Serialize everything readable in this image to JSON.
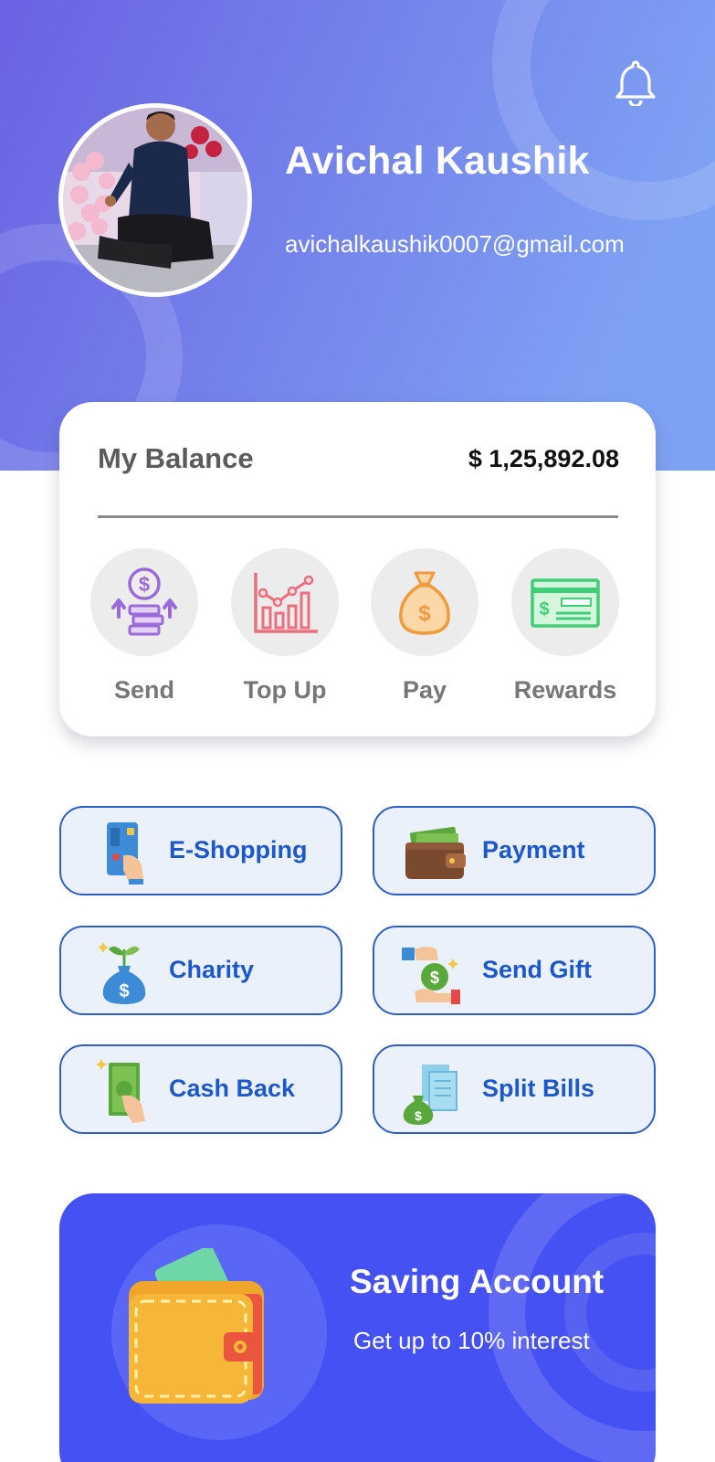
{
  "profile": {
    "name": "Avichal Kaushik",
    "email": "avichalkaushik0007@gmail.com"
  },
  "header": {
    "notification_icon": "bell-icon",
    "gradient_start": "#6a62e3",
    "gradient_end": "#7ea2f3"
  },
  "balance": {
    "label": "My Balance",
    "value": "$ 1,25,892.08"
  },
  "actions": [
    {
      "label": "Send",
      "icon": "send-money-icon"
    },
    {
      "label": "Top Up",
      "icon": "chart-icon"
    },
    {
      "label": "Pay",
      "icon": "money-bag-icon"
    },
    {
      "label": "Rewards",
      "icon": "cheque-icon"
    }
  ],
  "services": [
    {
      "label": "E-Shopping",
      "icon": "card-hand-icon"
    },
    {
      "label": "Payment",
      "icon": "wallet-icon"
    },
    {
      "label": "Charity",
      "icon": "plant-bag-icon"
    },
    {
      "label": "Send Gift",
      "icon": "gift-exchange-icon"
    },
    {
      "label": "Cash Back",
      "icon": "cash-hand-icon"
    },
    {
      "label": "Split Bills",
      "icon": "bills-icon"
    }
  ],
  "promo": {
    "title": "Saving Account",
    "subtitle": "Get up to 10% interest",
    "icon": "wallet-icon",
    "background": "#4551f2"
  }
}
